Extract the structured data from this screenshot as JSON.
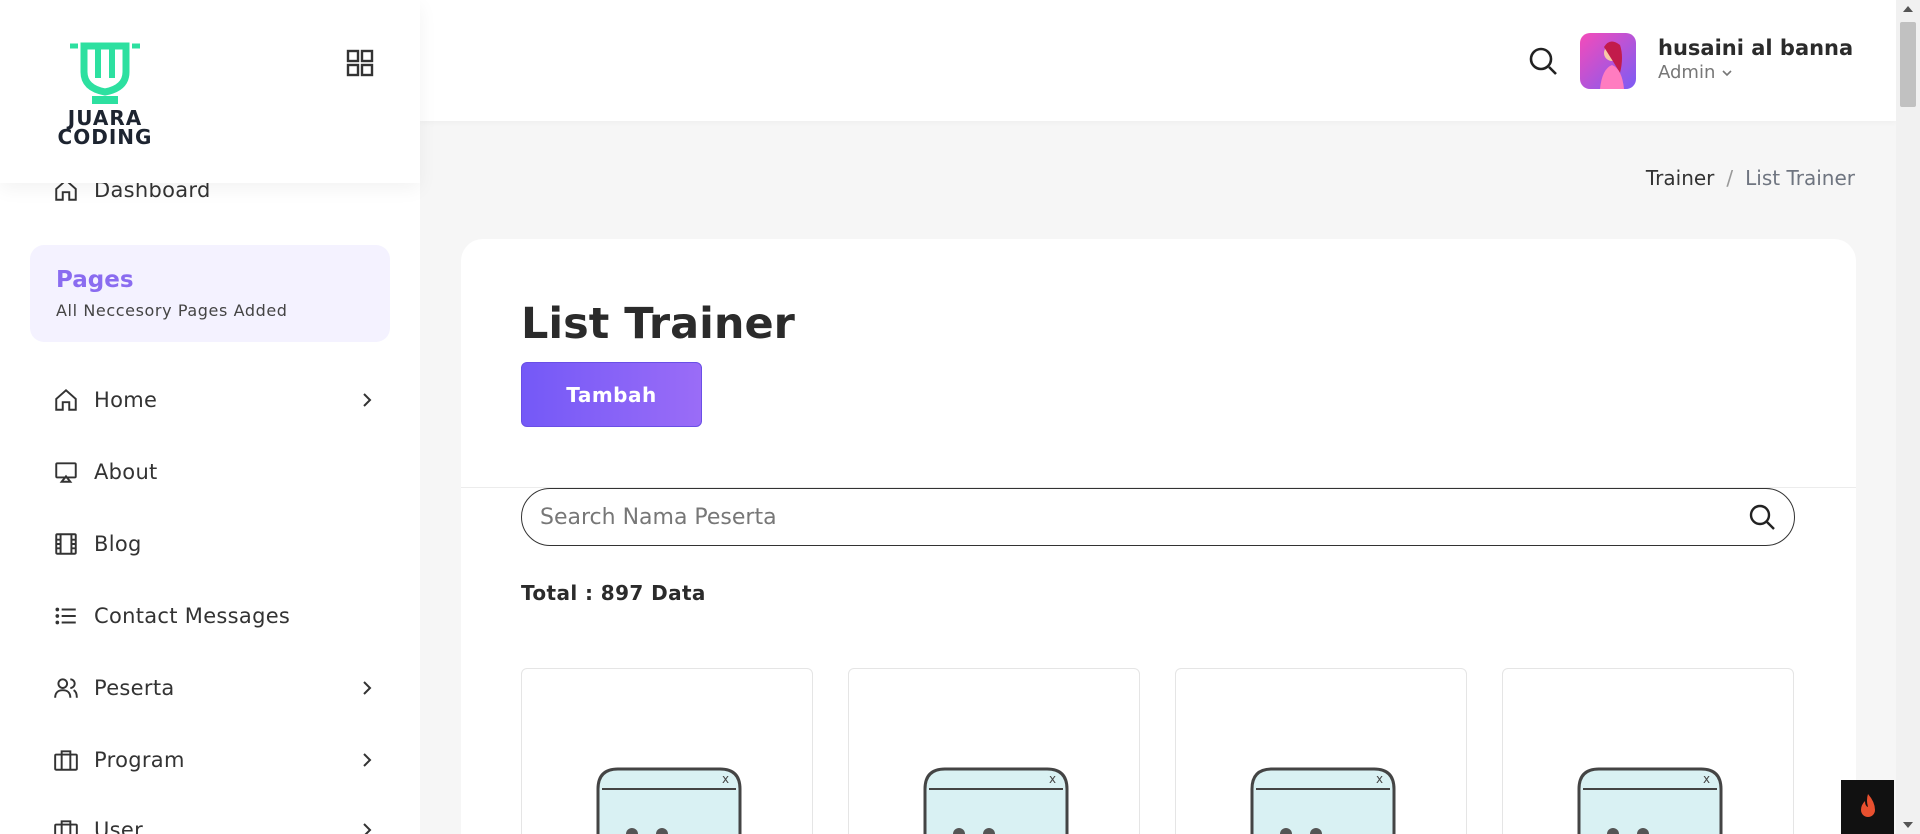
{
  "brand": {
    "logo_line1": "JUARA",
    "logo_line2": "CODING"
  },
  "sidebar": {
    "pages_title": "Pages",
    "pages_subtitle": "All Neccesory Pages Added",
    "items": [
      {
        "label": "Dashboard",
        "icon": "home-icon",
        "has_children": false
      },
      {
        "label": "Home",
        "icon": "home-icon",
        "has_children": true
      },
      {
        "label": "About",
        "icon": "airplay-icon",
        "has_children": false
      },
      {
        "label": "Blog",
        "icon": "film-icon",
        "has_children": false
      },
      {
        "label": "Contact Messages",
        "icon": "list-icon",
        "has_children": false
      },
      {
        "label": "Peserta",
        "icon": "users-icon",
        "has_children": true
      },
      {
        "label": "Program",
        "icon": "briefcase-icon",
        "has_children": true
      },
      {
        "label": "User",
        "icon": "briefcase-icon",
        "has_children": true
      }
    ]
  },
  "header": {
    "user_name": "husaini al banna",
    "user_role": "Admin"
  },
  "breadcrumb": {
    "parent": "Trainer",
    "separator": "/",
    "current": "List Trainer"
  },
  "main": {
    "title": "List Trainer",
    "add_button": "Tambah",
    "search_placeholder": "Search Nama Peserta",
    "total_text": "Total : 897 Data"
  },
  "colors": {
    "accent": "#7459f7",
    "brand_green": "#2de0a0",
    "pages_bg": "#f4f2ff"
  }
}
